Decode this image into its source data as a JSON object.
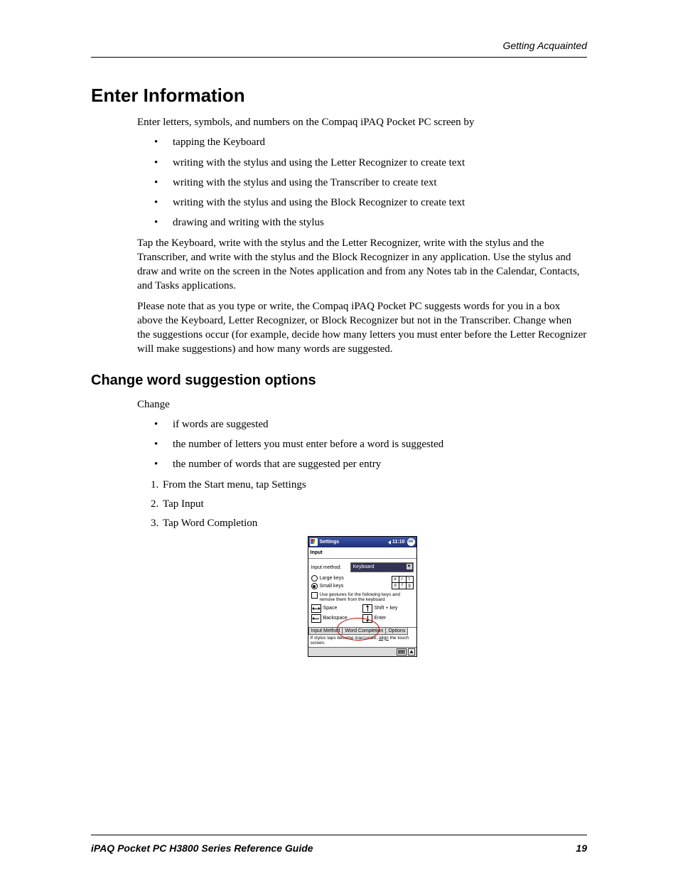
{
  "header": {
    "section": "Getting Acquainted"
  },
  "title": "Enter Information",
  "intro": "Enter letters, symbols, and numbers on the Compaq iPAQ Pocket PC screen by",
  "bullets1": [
    "tapping the Keyboard",
    "writing with the stylus and using the Letter Recognizer to create text",
    "writing with the stylus and using the Transcriber to create text",
    "writing with the stylus and using the Block Recognizer to create text",
    "drawing and writing with the stylus"
  ],
  "para2": "Tap the Keyboard, write with the stylus and the Letter Recognizer, write with the stylus and the Transcriber, and write with the stylus and the Block Recognizer in any application. Use the stylus and draw and write on the screen in the Notes application and from any Notes tab in the Calendar, Contacts, and Tasks applications.",
  "para3": "Please note that as you type or write, the Compaq iPAQ Pocket PC suggests words for you in a box above the Keyboard, Letter Recognizer, or Block Recognizer but not in the Transcriber. Change when the suggestions occur (for example, decide how many letters you must enter before the Letter Recognizer will make suggestions) and how many words are suggested.",
  "subtitle": "Change word suggestion options",
  "change_label": "Change",
  "bullets2": [
    "if words are suggested",
    "the number of letters you must enter before a word is suggested",
    "the number of words that are suggested per entry"
  ],
  "steps": [
    "From the Start menu, tap Settings",
    "Tap Input",
    "Tap Word Completion"
  ],
  "screenshot": {
    "title": "Settings",
    "time": "11:10",
    "ok": "ok",
    "app_label": "Input",
    "input_method_label": "Input method:",
    "input_method_value": "Keyboard",
    "large_keys": "Large keys",
    "small_keys": "Small keys",
    "keycaps_top": [
      "e",
      "r",
      "t"
    ],
    "keycaps_bot": [
      "d",
      "f",
      "g"
    ],
    "gesture_text": "Use gestures for the following keys and remove them from the keyboard",
    "g_space": "Space",
    "g_shift": "Shift + key",
    "g_back": "Backspace",
    "g_enter": "Enter",
    "tabs": {
      "t1": "Input Method",
      "t2": "Word Completion",
      "t3": "Options"
    },
    "hint_pre": "If stylus taps become inaccurate, ",
    "hint_link": "align",
    "hint_post": " the touch screen."
  },
  "footer": {
    "left": "iPAQ Pocket PC H3800 Series Reference Guide",
    "right": "19"
  }
}
